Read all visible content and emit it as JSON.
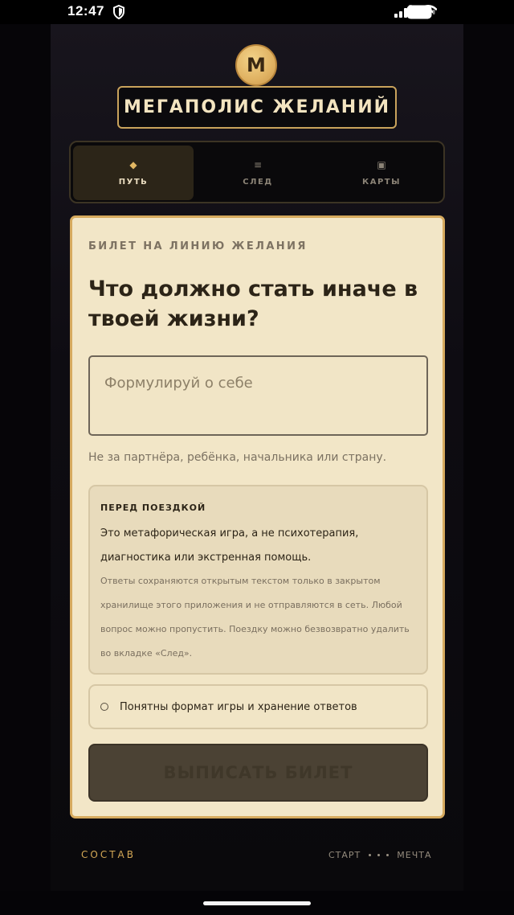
{
  "status_bar": {
    "time": "12:47"
  },
  "app": {
    "logo_letter": "М",
    "title": "МЕГАПОЛИС ЖЕЛАНИЙ",
    "tabs": [
      {
        "icon": "◆",
        "label": "ПУТЬ",
        "active": true
      },
      {
        "icon": "≡",
        "label": "СЛЕД",
        "active": false
      },
      {
        "icon": "▣",
        "label": "КАРТЫ",
        "active": false
      }
    ]
  },
  "card": {
    "eyebrow": "БИЛЕТ НА ЛИНИЮ ЖЕЛАНИЯ",
    "question": "Что должно стать иначе в твоей жизни?",
    "answer_value": "",
    "answer_placeholder": "Формулируй о себе",
    "hint": "Не за партнёра, ребёнка, начальника или страну.",
    "notice": {
      "title": "ПЕРЕД ПОЕЗДКОЙ",
      "main": "Это метафорическая игра, а не психотерапия, диагностика или экстренная помощь.",
      "sub": "Ответы сохраняются открытым текстом только в закрытом хранилище этого приложения и не отправляются в сеть. Любой вопрос можно пропустить. Поездку можно безвозвратно удалить во вкладке «След»."
    },
    "consent_label": "Понятны формат игры и хранение ответов",
    "consent_checked": false,
    "submit_label": "ВЫПИСАТЬ БИЛЕТ"
  },
  "footer": {
    "left": "СОСТАВ",
    "route_start": "СТАРТ",
    "route_end": "МЕЧТА"
  }
}
